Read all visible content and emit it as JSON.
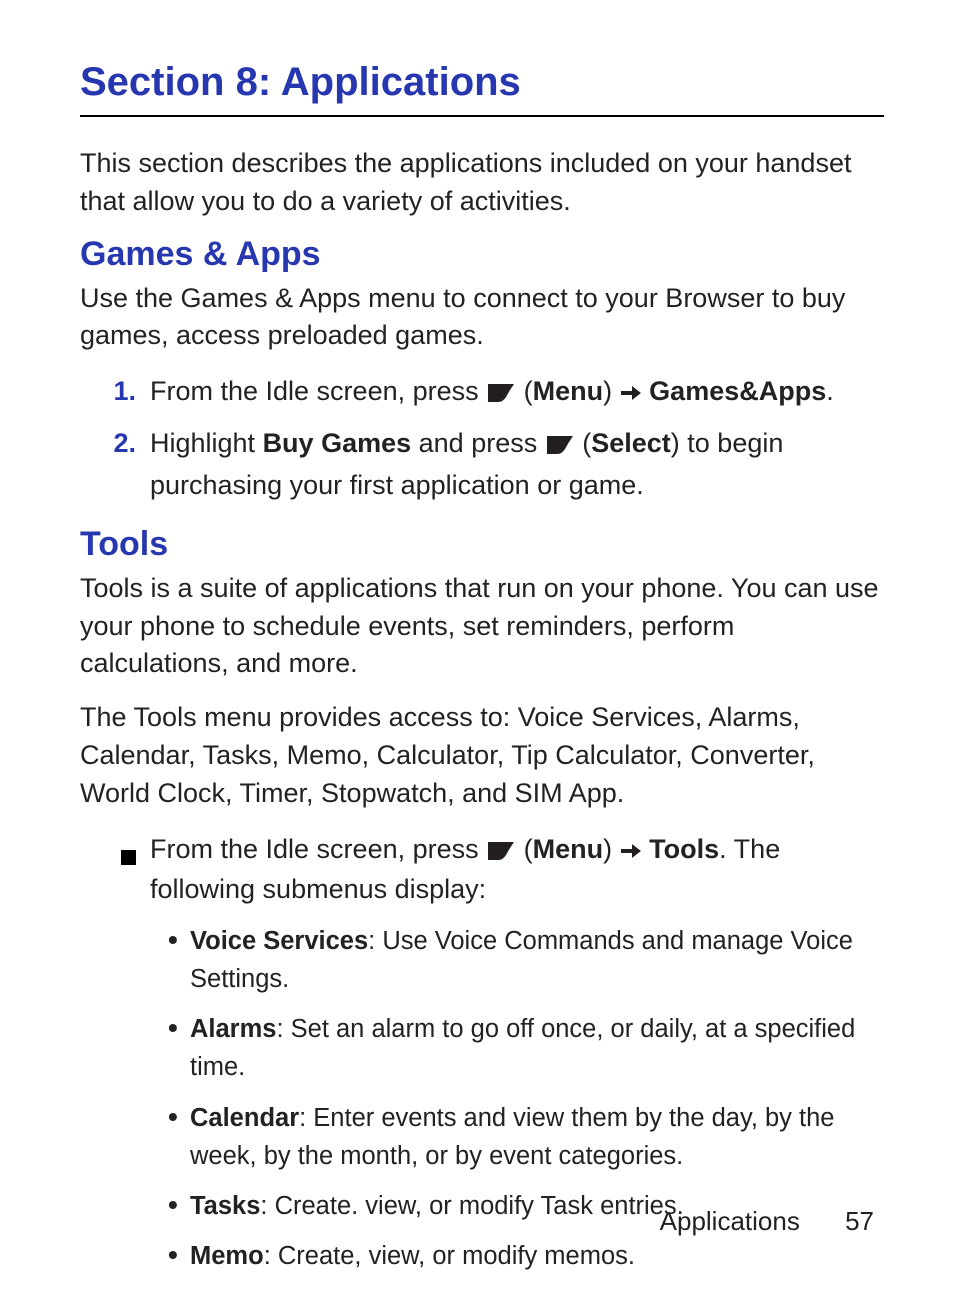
{
  "title": "Section 8: Applications",
  "intro": "This section describes the applications included on your handset that allow you to do a variety of activities.",
  "games": {
    "heading": "Games & Apps",
    "para": "Use the Games & Apps menu to connect to your Browser to buy games, access preloaded games.",
    "step1": {
      "num": "1.",
      "pre": "From the Idle screen, press ",
      "paren_open": " (",
      "menu": "Menu",
      "paren_close": ") ",
      "target": "Games&Apps",
      "end": "."
    },
    "step2": {
      "num": "2.",
      "pre": "Highlight ",
      "bold1": "Buy Games",
      "mid": " and press ",
      "paren_open": " (",
      "select": "Select",
      "paren_close": ") to begin purchasing your first application or game."
    }
  },
  "tools": {
    "heading": "Tools",
    "para1": "Tools is a suite of applications that run on your phone. You can use your phone to schedule events, set reminders, perform calculations, and more.",
    "para2": "The Tools menu provides access to: Voice Services, Alarms, Calendar, Tasks, Memo, Calculator, Tip Calculator, Converter, World Clock, Timer, Stopwatch, and SIM App.",
    "square": {
      "pre": "From the Idle screen, press ",
      "paren_open": " (",
      "menu": "Menu",
      "paren_close": ") ",
      "target": "Tools",
      "end": ". The following submenus display:"
    },
    "bullets": [
      {
        "term": "Voice Services",
        "desc": ": Use Voice Commands and manage Voice Settings."
      },
      {
        "term": "Alarms",
        "desc": ": Set an alarm to go off once, or daily, at a specified time."
      },
      {
        "term": "Calendar",
        "desc": ": Enter events and view them by the day, by the week, by the month, or by event categories."
      },
      {
        "term": "Tasks",
        "desc": ": Create. view, or modify Task entries."
      },
      {
        "term": "Memo",
        "desc": ": Create, view, or modify memos."
      }
    ]
  },
  "footer": {
    "label": "Applications",
    "page": "57"
  }
}
